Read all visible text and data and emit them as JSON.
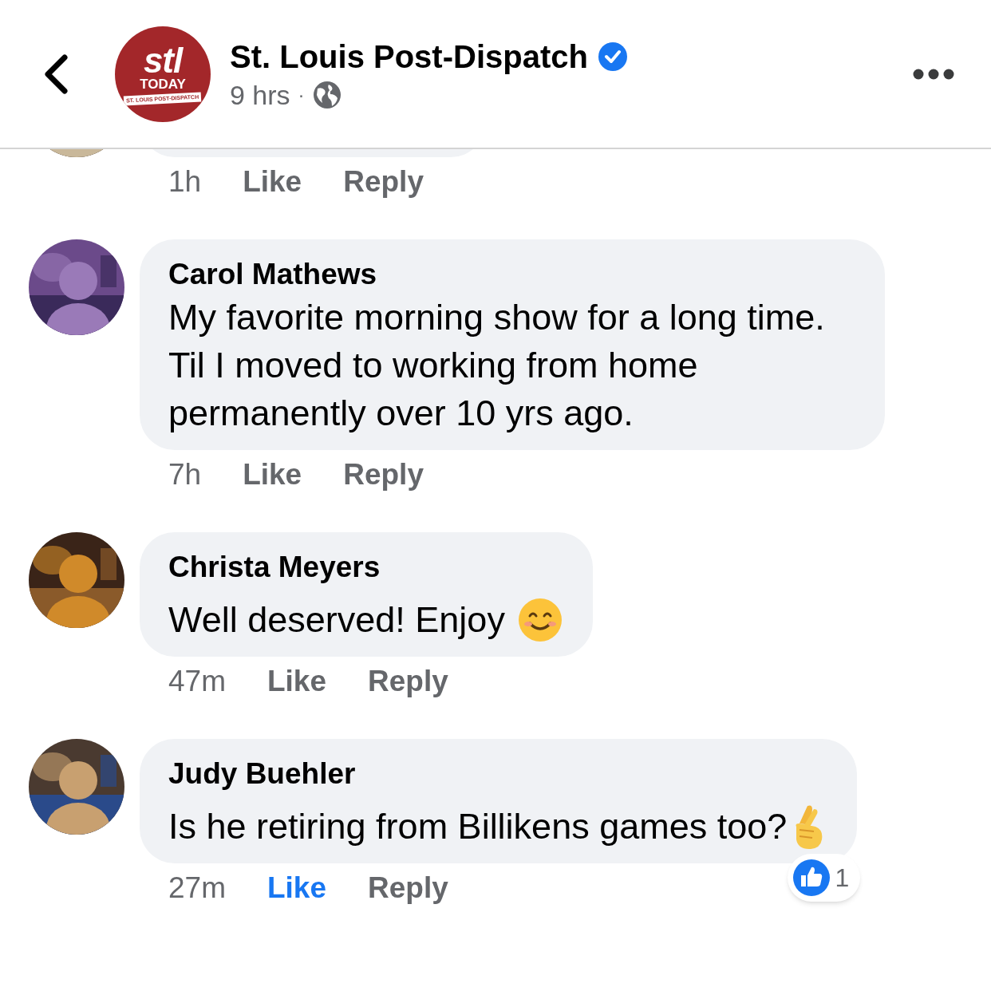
{
  "header": {
    "page_name": "St. Louis Post-Dispatch",
    "verified": true,
    "time": "9 hrs",
    "separator": "·",
    "logo": {
      "mark": "stl",
      "word": "TODAY",
      "banner": "ST. LOUIS POST-DISPATCH"
    }
  },
  "comments": [
    {
      "time": "1h",
      "like": "Like",
      "liked": false,
      "reply": "Reply"
    },
    {
      "name": "Carol Mathews",
      "text": "My favorite morning show for a long time. Til I moved to working from home permanently over 10 yrs ago.",
      "time": "7h",
      "like": "Like",
      "liked": false,
      "reply": "Reply"
    },
    {
      "name": "Christa Meyers",
      "text": "Well deserved! Enjoy",
      "kind": "smile",
      "time": "47m",
      "like": "Like",
      "liked": false,
      "reply": "Reply"
    },
    {
      "name": "Judy Buehler",
      "text": "Is he retiring from Billikens games too?",
      "kind": "fingers",
      "time": "27m",
      "like": "Like",
      "liked": true,
      "reply": "Reply",
      "reactions": "1"
    }
  ]
}
